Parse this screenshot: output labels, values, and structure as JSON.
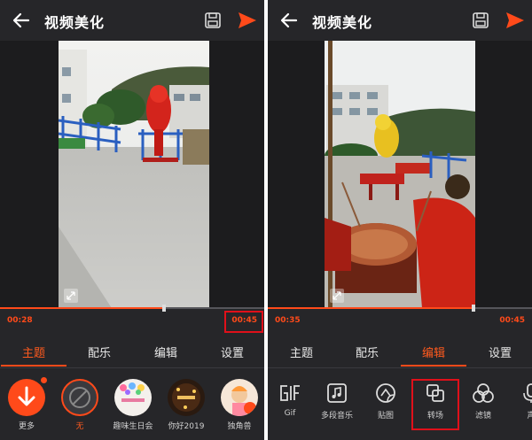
{
  "left": {
    "title": "视频美化",
    "time_current": "00:28",
    "time_total": "00:45",
    "progress_fraction": 0.62,
    "tabs": [
      "主题",
      "配乐",
      "编辑",
      "设置"
    ],
    "active_tab": 0,
    "themes": [
      {
        "label": "更多",
        "icon": "download-icon"
      },
      {
        "label": "无",
        "icon": "none-icon"
      },
      {
        "label": "趣味生日会",
        "icon": "birthday-thumb"
      },
      {
        "label": "你好2019",
        "icon": "newyear-thumb"
      },
      {
        "label": "独角兽",
        "icon": "unicorn-thumb"
      }
    ]
  },
  "right": {
    "title": "视频美化",
    "time_current": "00:35",
    "time_total": "00:45",
    "progress_fraction": 0.78,
    "tabs": [
      "主题",
      "配乐",
      "编辑",
      "设置"
    ],
    "active_tab": 2,
    "tools": [
      {
        "label": "Gif",
        "icon": "gif-icon"
      },
      {
        "label": "多段音乐",
        "icon": "music-icon"
      },
      {
        "label": "贴图",
        "icon": "sticker-icon"
      },
      {
        "label": "转场",
        "icon": "transition-icon"
      },
      {
        "label": "滤镜",
        "icon": "filter-icon"
      },
      {
        "label": "声",
        "icon": "voice-icon"
      }
    ]
  },
  "colors": {
    "accent": "#ff4a1a",
    "background": "#262629",
    "highlight_box": "#e0101a"
  }
}
